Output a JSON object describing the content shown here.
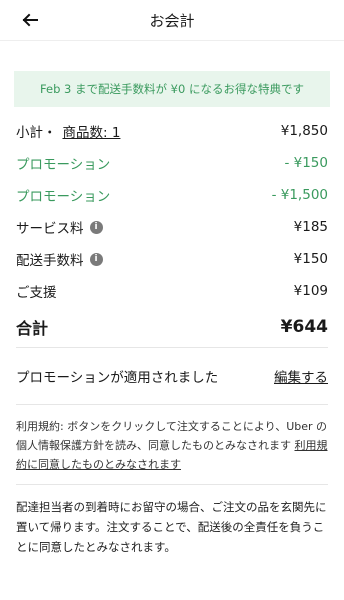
{
  "header": {
    "title": "お会計",
    "back_icon": "arrow-left-icon"
  },
  "promo_banner": "Feb 3 まで配送手数料が ¥0 になるお得な特典です",
  "summary": {
    "subtotal_prefix": "小計・",
    "subtotal_link": "商品数: 1",
    "subtotal_value": "¥1,850",
    "promo1_label": "プロモーション",
    "promo1_value": "- ¥150",
    "promo2_label": "プロモーション",
    "promo2_value": "- ¥1,500",
    "service_fee_label": "サービス料",
    "service_fee_value": "¥185",
    "delivery_fee_label": "配送手数料",
    "delivery_fee_value": "¥150",
    "support_label": "ご支援",
    "support_value": "¥109",
    "total_label": "合計",
    "total_value": "¥644"
  },
  "promo_applied": {
    "text": "プロモーションが適用されました",
    "edit_label": "編集する"
  },
  "terms": {
    "text": "利用規約: ボタンをクリックして注文することにより、Uber の個人情報保護方針を読み、同意したものとみなされます ",
    "link": "利用規約に同意したものとみなされます"
  },
  "delivery_note": "配達担当者の到着時にお留守の場合、ご注文の品を玄関先に置いて帰ります。注文することで、配送後の全責任を負うことに同意したとみなされます。",
  "colors": {
    "promo_green": "#3a9a5e",
    "banner_bg": "#e8f5ec"
  }
}
